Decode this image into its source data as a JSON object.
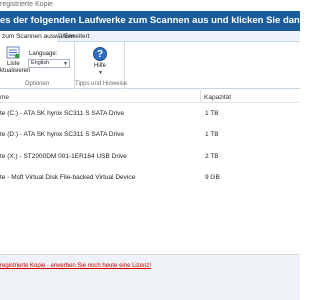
{
  "window": {
    "title": "registrierte Kopie"
  },
  "banner": {
    "text": "es der folgenden Laufwerke zum Scannen aus und klicken Sie dann auf \"Weiter\":"
  },
  "ribbon": {
    "tabs": [
      {
        "label": "zum Scannen auswählen",
        "active": true
      },
      {
        "label": "Erweitert",
        "active": false
      }
    ],
    "options_group": {
      "label": "Optionen",
      "refresh_button": {
        "line1": "Liste",
        "line2": "ktualisieren"
      },
      "language": {
        "label": "Language:",
        "value": "English"
      }
    },
    "tips_group": {
      "label": "Tipps und Hinweise",
      "help_button": {
        "label": "Hilfe"
      }
    }
  },
  "table": {
    "columns": [
      {
        "label": "me"
      },
      {
        "label": "Kapazität"
      }
    ],
    "rows": [
      {
        "name": "te (C:) - ATA SK hynix SC311 S SATA Drive",
        "capacity": "1 TB"
      },
      {
        "name": "te (D:) - ATA SK hynix SC311 S SATA Drive",
        "capacity": "1 TB"
      },
      {
        "name": "te (X:) - ST2000DM 001-1ER164 USB Drive",
        "capacity": "2 TB"
      },
      {
        "name": "te - Msft Virtual Disk File-backed Virtual Device",
        "capacity": "9 GB"
      }
    ]
  },
  "footer": {
    "link_text": "registrierte Kopie - erwerben Sie noch heute eine Lizenz!"
  },
  "colors": {
    "banner": "#1b5c9a",
    "footer_link": "#d00000"
  },
  "icons": {
    "refresh": "list-refresh-icon",
    "help": "help-icon",
    "dropdown": "chevron-down-icon"
  }
}
